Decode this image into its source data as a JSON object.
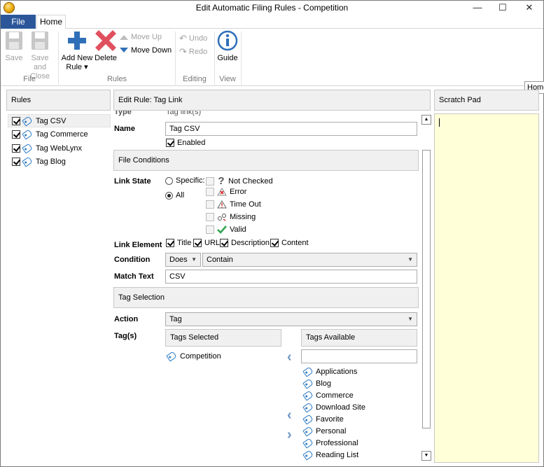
{
  "window": {
    "title": "Edit Automatic Filing Rules - Competition",
    "minimize": "—",
    "maximize": "☐",
    "close": "✕"
  },
  "tabs": {
    "file": "File",
    "home": "Home"
  },
  "ribbon": {
    "save": "Save",
    "save_close_1": "Save and",
    "save_close_2": "Close",
    "add_new_1": "Add New",
    "add_new_2": "Rule ▾",
    "delete": "Delete",
    "move_up": "Move Up",
    "move_down": "Move Down",
    "undo": "Undo",
    "redo": "Redo",
    "guide": "Guide",
    "groups": {
      "file": "File",
      "rules": "Rules",
      "editing": "Editing",
      "view": "View"
    }
  },
  "tooltip": "Home",
  "rules_panel": {
    "header": "Rules",
    "items": [
      {
        "label": "Tag CSV",
        "checked": true,
        "selected": true
      },
      {
        "label": "Tag Commerce",
        "checked": true
      },
      {
        "label": "Tag WebLynx",
        "checked": true
      },
      {
        "label": "Tag Blog",
        "checked": true
      }
    ]
  },
  "editor": {
    "header": "Edit Rule: Tag Link",
    "type_label": "Type",
    "type_value": "Tag link(s)",
    "name_label": "Name",
    "name_value": "Tag CSV",
    "enabled_label": "Enabled",
    "file_conditions": "File Conditions",
    "link_state_label": "Link State",
    "specific_label": "Specific:",
    "all_label": "All",
    "states": [
      "Not Checked",
      "Error",
      "Time Out",
      "Missing",
      "Valid"
    ],
    "link_element_label": "Link Element",
    "elements": [
      "Title",
      "URL",
      "Description",
      "Content"
    ],
    "condition_label": "Condition",
    "condition_does": "Does",
    "condition_contain": "Contain",
    "match_text_label": "Match Text",
    "match_text_value": "CSV",
    "tag_selection": "Tag Selection",
    "action_label": "Action",
    "action_value": "Tag",
    "tags_label": "Tag(s)",
    "tags_selected_header": "Tags Selected",
    "tags_available_header": "Tags Available",
    "tags_selected": [
      "Competition"
    ],
    "tags_available": [
      "Applications",
      "Blog",
      "Commerce",
      "Download Site",
      "Favorite",
      "Personal",
      "Professional",
      "Reading List"
    ]
  },
  "scratch_pad": {
    "header": "Scratch Pad"
  },
  "colors": {
    "file_tab": "#2b579a",
    "accent_blue": "#2f7cc4",
    "scratch_bg": "#ffffd8",
    "delete_red": "#e0505e"
  }
}
